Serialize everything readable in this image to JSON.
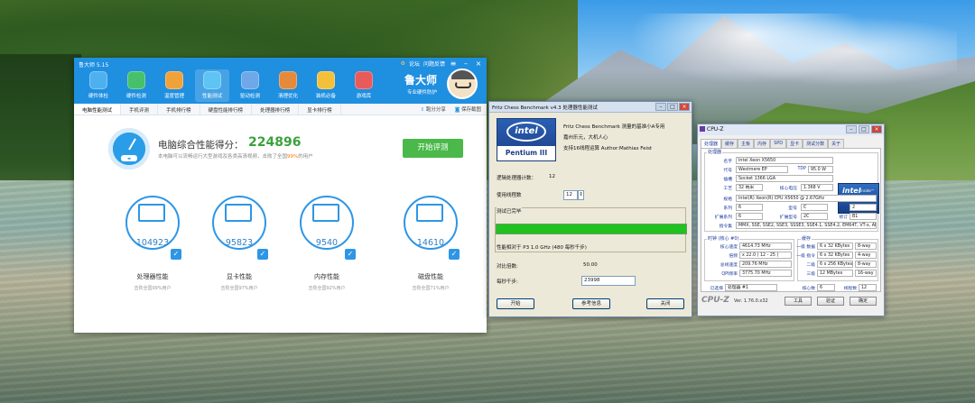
{
  "ludashi": {
    "title": "鲁大师 5.15",
    "top_links": [
      "论坛",
      "问题反馈"
    ],
    "nav": [
      {
        "label": "硬件体检",
        "icon": "monitor-icon",
        "color": "#4fb0ef"
      },
      {
        "label": "硬件检测",
        "icon": "chip-icon",
        "color": "#47c06b"
      },
      {
        "label": "温度管理",
        "icon": "thermometer-chart-icon",
        "color": "#f0a23a"
      },
      {
        "label": "性能测试",
        "icon": "speedometer-icon",
        "color": "#5ec4f4"
      },
      {
        "label": "驱动检测",
        "icon": "driver-disc-icon",
        "color": "#6fa8e8"
      },
      {
        "label": "清理优化",
        "icon": "broom-icon",
        "color": "#e58a3b"
      },
      {
        "label": "装机必备",
        "icon": "apps-cube-icon",
        "color": "#f4c03a"
      },
      {
        "label": "游戏库",
        "icon": "gamepad-icon",
        "color": "#e95a5a"
      }
    ],
    "brand_name": "鲁大师",
    "brand_slogan": "专业硬件防护",
    "tabs": [
      "电脑性能测试",
      "手机评测",
      "手机排行榜",
      "硬盘性能排行榜",
      "处理器排行榜",
      "显卡排行榜"
    ],
    "tabs_right": [
      "跑分分享",
      "保存截图"
    ],
    "score_title": "电脑综合性能得分：",
    "score_value": "224896",
    "score_desc_pre": "本电脑可以流畅运行大型游戏及各类高清视频，击败了全国",
    "score_desc_pct": "99%",
    "score_desc_post": "的用户",
    "start_button": "开始评测",
    "categories": [
      {
        "value": "104923",
        "label": "处理器性能",
        "sub": "击败全国99%用户"
      },
      {
        "value": "95823",
        "label": "显卡性能",
        "sub": "击败全国97%用户"
      },
      {
        "value": "9540",
        "label": "内存性能",
        "sub": "击败全国92%用户"
      },
      {
        "value": "14610",
        "label": "磁盘性能",
        "sub": "击败全国71%用户"
      }
    ]
  },
  "fritz": {
    "title": "Fritz Chess Benchmark v4.3   处理器性能测试",
    "logo_brand": "intel",
    "logo_product": "Pentium III",
    "info_line1": "Fritz Chess Benchmark 测量的基准小A专用",
    "info_line2": "嘉州乐元，大机人心",
    "info_line3": "支持16线程运算    Author:Mathias Feist",
    "label_cpus": "逻辑处理器计数：",
    "cpus_value": "12",
    "label_threads": "使用线程数",
    "threads_value": "12",
    "group_title": "测试已完毕",
    "ratio_line": "性能相对于 P3 1.0 GHz (480 每秒千步)",
    "label_ratio": "对比倍数:",
    "ratio_value": "50.00",
    "label_kn": "每秒千步:",
    "kn_value": "23998",
    "progress": 1.0,
    "buttons": [
      "开始",
      "参考信息",
      "关闭"
    ]
  },
  "cpuz": {
    "title": "CPU-Z",
    "tabs": [
      "处理器",
      "缓存",
      "主板",
      "内存",
      "SPD",
      "显卡",
      "测试分数",
      "关于"
    ],
    "section_processor": "处理器",
    "name_label": "名字",
    "name_value": "Intel Xeon X5650",
    "codename_label": "代号",
    "codename_value": "Westmere EP",
    "tdp_label": "TDP",
    "tdp_value": "95.0 W",
    "package_label": "插槽",
    "package_value": "Socket 1366 LGA",
    "tech_label": "工艺",
    "tech_value": "32 纳米",
    "voltage_label": "核心电压",
    "voltage_value": "1.368 V",
    "spec_label": "规格",
    "spec_value": "Intel(R) Xeon(R) CPU        X5650  @ 2.67GHz",
    "family_label": "系列",
    "family_value": "6",
    "model_label": "型号",
    "model_value": "C",
    "stepping_label": "步进",
    "stepping_value": "2",
    "extfamily_label": "扩展系列",
    "extfamily_value": "6",
    "extmodel_label": "扩展型号",
    "extmodel_value": "2C",
    "revision_label": "修订",
    "revision_value": "B1",
    "instr_label": "指令集",
    "instr_value": "MMX, SSE, SSE2, SSE3, SSSE3, SSE4.1, SSE4.2, EM64T, VT-x, AES",
    "clocks_title": "时钟 (核心 #0)",
    "corespeed_label": "核心速度",
    "corespeed_value": "4614.73 MHz",
    "multiplier_label": "倍频",
    "multiplier_value": "x 22.0 ( 12 - 25 )",
    "bus_label": "总线速度",
    "bus_value": "209.76 MHz",
    "qpi_label": "QPI频率",
    "qpi_value": "3775.70 MHz",
    "cache_title": "缓存",
    "l1d_label": "一级 数据",
    "l1d_value": "6 x 32 KBytes",
    "l1d_way": "8-way",
    "l1i_label": "一级 指令",
    "l1i_value": "6 x 32 KBytes",
    "l1i_way": "4-way",
    "l2_label": "二级",
    "l2_value": "6 x 256 KBytes",
    "l2_way": "8-way",
    "l3_label": "三级",
    "l3_value": "12 MBytes",
    "l3_way": "16-way",
    "selected_label": "已选择",
    "selected_value": "处理器 #1",
    "cores_label": "核心数",
    "cores_value": "6",
    "threads_label": "线程数",
    "threads_value": "12",
    "logo": "CPU-Z",
    "version": "Ver. 1.76.0.x32",
    "tools_button": "工具",
    "validate_button": "验证",
    "ok_button": "确定"
  }
}
